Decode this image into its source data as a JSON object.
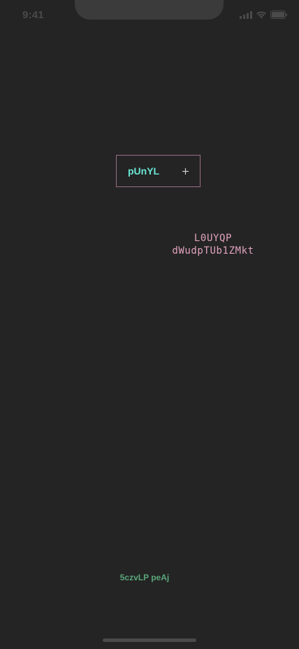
{
  "status_bar": {
    "time": "9:41",
    "icons": [
      "signal-icon",
      "wifi-icon",
      "battery-icon"
    ]
  },
  "chip": {
    "label": "pUnYL",
    "icon": "plus-icon"
  },
  "mono_text": {
    "line1": "L0UYQP",
    "line2": "dWudpTUb1ZMkt"
  },
  "footer": {
    "text": "5czvLP peAj"
  },
  "colors": {
    "background": "#242424",
    "chip_border": "#9a6e87",
    "chip_text": "#6be6d6",
    "mono_text": "#e1a3be",
    "footer_text": "#5aa67b"
  }
}
